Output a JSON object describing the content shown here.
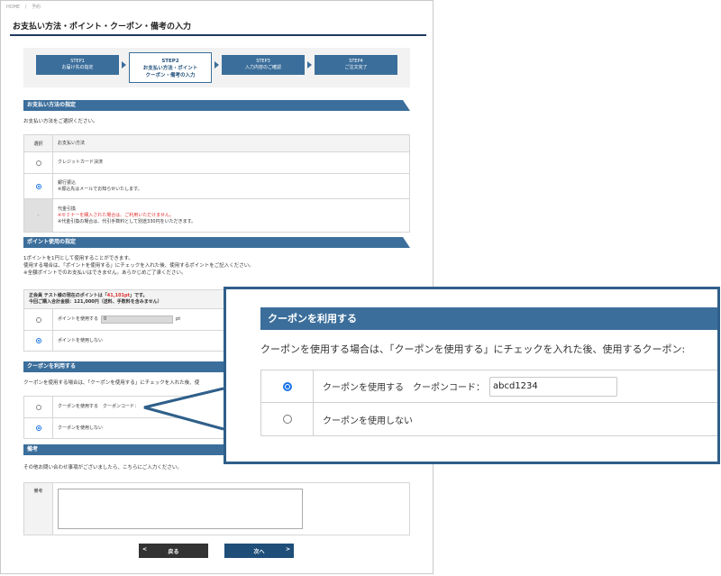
{
  "breadcrumb": [
    "HOME",
    "/",
    "予約"
  ],
  "page_title": "お支払い方法・ポイント・クーポン・備考の入力",
  "steps": [
    {
      "num": "STEP1",
      "label": "お届け先の指定"
    },
    {
      "num": "STEP2",
      "label1": "お支払い方法・ポイント",
      "label2": "クーポン・備考の入力"
    },
    {
      "num": "STEP3",
      "label": "入力内容のご確認"
    },
    {
      "num": "STEP4",
      "label": "ご注文完了"
    }
  ],
  "payment": {
    "heading": "お支払い方法の指定",
    "desc": "お支払い方法をご選択ください。",
    "col_select": "選択",
    "col_method": "お支払い方法",
    "rows": [
      {
        "name": "クレジットカード決済"
      },
      {
        "name": "銀行振込",
        "note": "※振込先はメールでお知らせいたします。"
      },
      {
        "name": "代金引換",
        "warn": "※セミナーを購入された場合は、ご利用いただけません。",
        "note": "※代金引換の場合は、代引手数料として別途330円をいただきます。",
        "dash": "-"
      }
    ]
  },
  "points": {
    "heading": "ポイント使用の指定",
    "desc1": "1ポイントを1円として使用することができます。",
    "desc2": "使用する場合は、「ポイントを使用する」にチェックを入れた後、使用するポイントをご記入ください。",
    "desc3": "※全額ポイントでのお支払いはできません。あらかじめご了承ください。",
    "summary_pre": "正会員 テスト様の現在のポイントは「",
    "summary_pts": "41,101pt",
    "summary_post": "」です。",
    "summary2": "今回ご購入合計金額：121,000円（送料、手数料を含みません）",
    "use_label": "ポイントを使用する",
    "input_value": "0",
    "unit": "pt",
    "nouse_label": "ポイントを使用しない"
  },
  "coupon": {
    "heading": "クーポンを利用する",
    "desc": "クーポンを使用する場合は、「クーポンを使用する」にチェックを入れた後、使",
    "use_label": "クーポンを使用する　クーポンコード：",
    "nouse_label": "クーポンを使用しない"
  },
  "remarks": {
    "heading": "備考",
    "desc": "その他お問い合わせ事項がございましたら、こちらにご入力ください。",
    "label": "備考"
  },
  "buttons": {
    "back": "戻る",
    "next": "次へ"
  },
  "zoom": {
    "heading": "クーポンを利用する",
    "desc": "クーポンを使用する場合は、「クーポンを使用する」にチェックを入れた後、使用するクーポン:",
    "use_label": "クーポンを使用する　クーポンコード：",
    "code_value": "abcd1234",
    "nouse_label": "クーポンを使用しない"
  }
}
